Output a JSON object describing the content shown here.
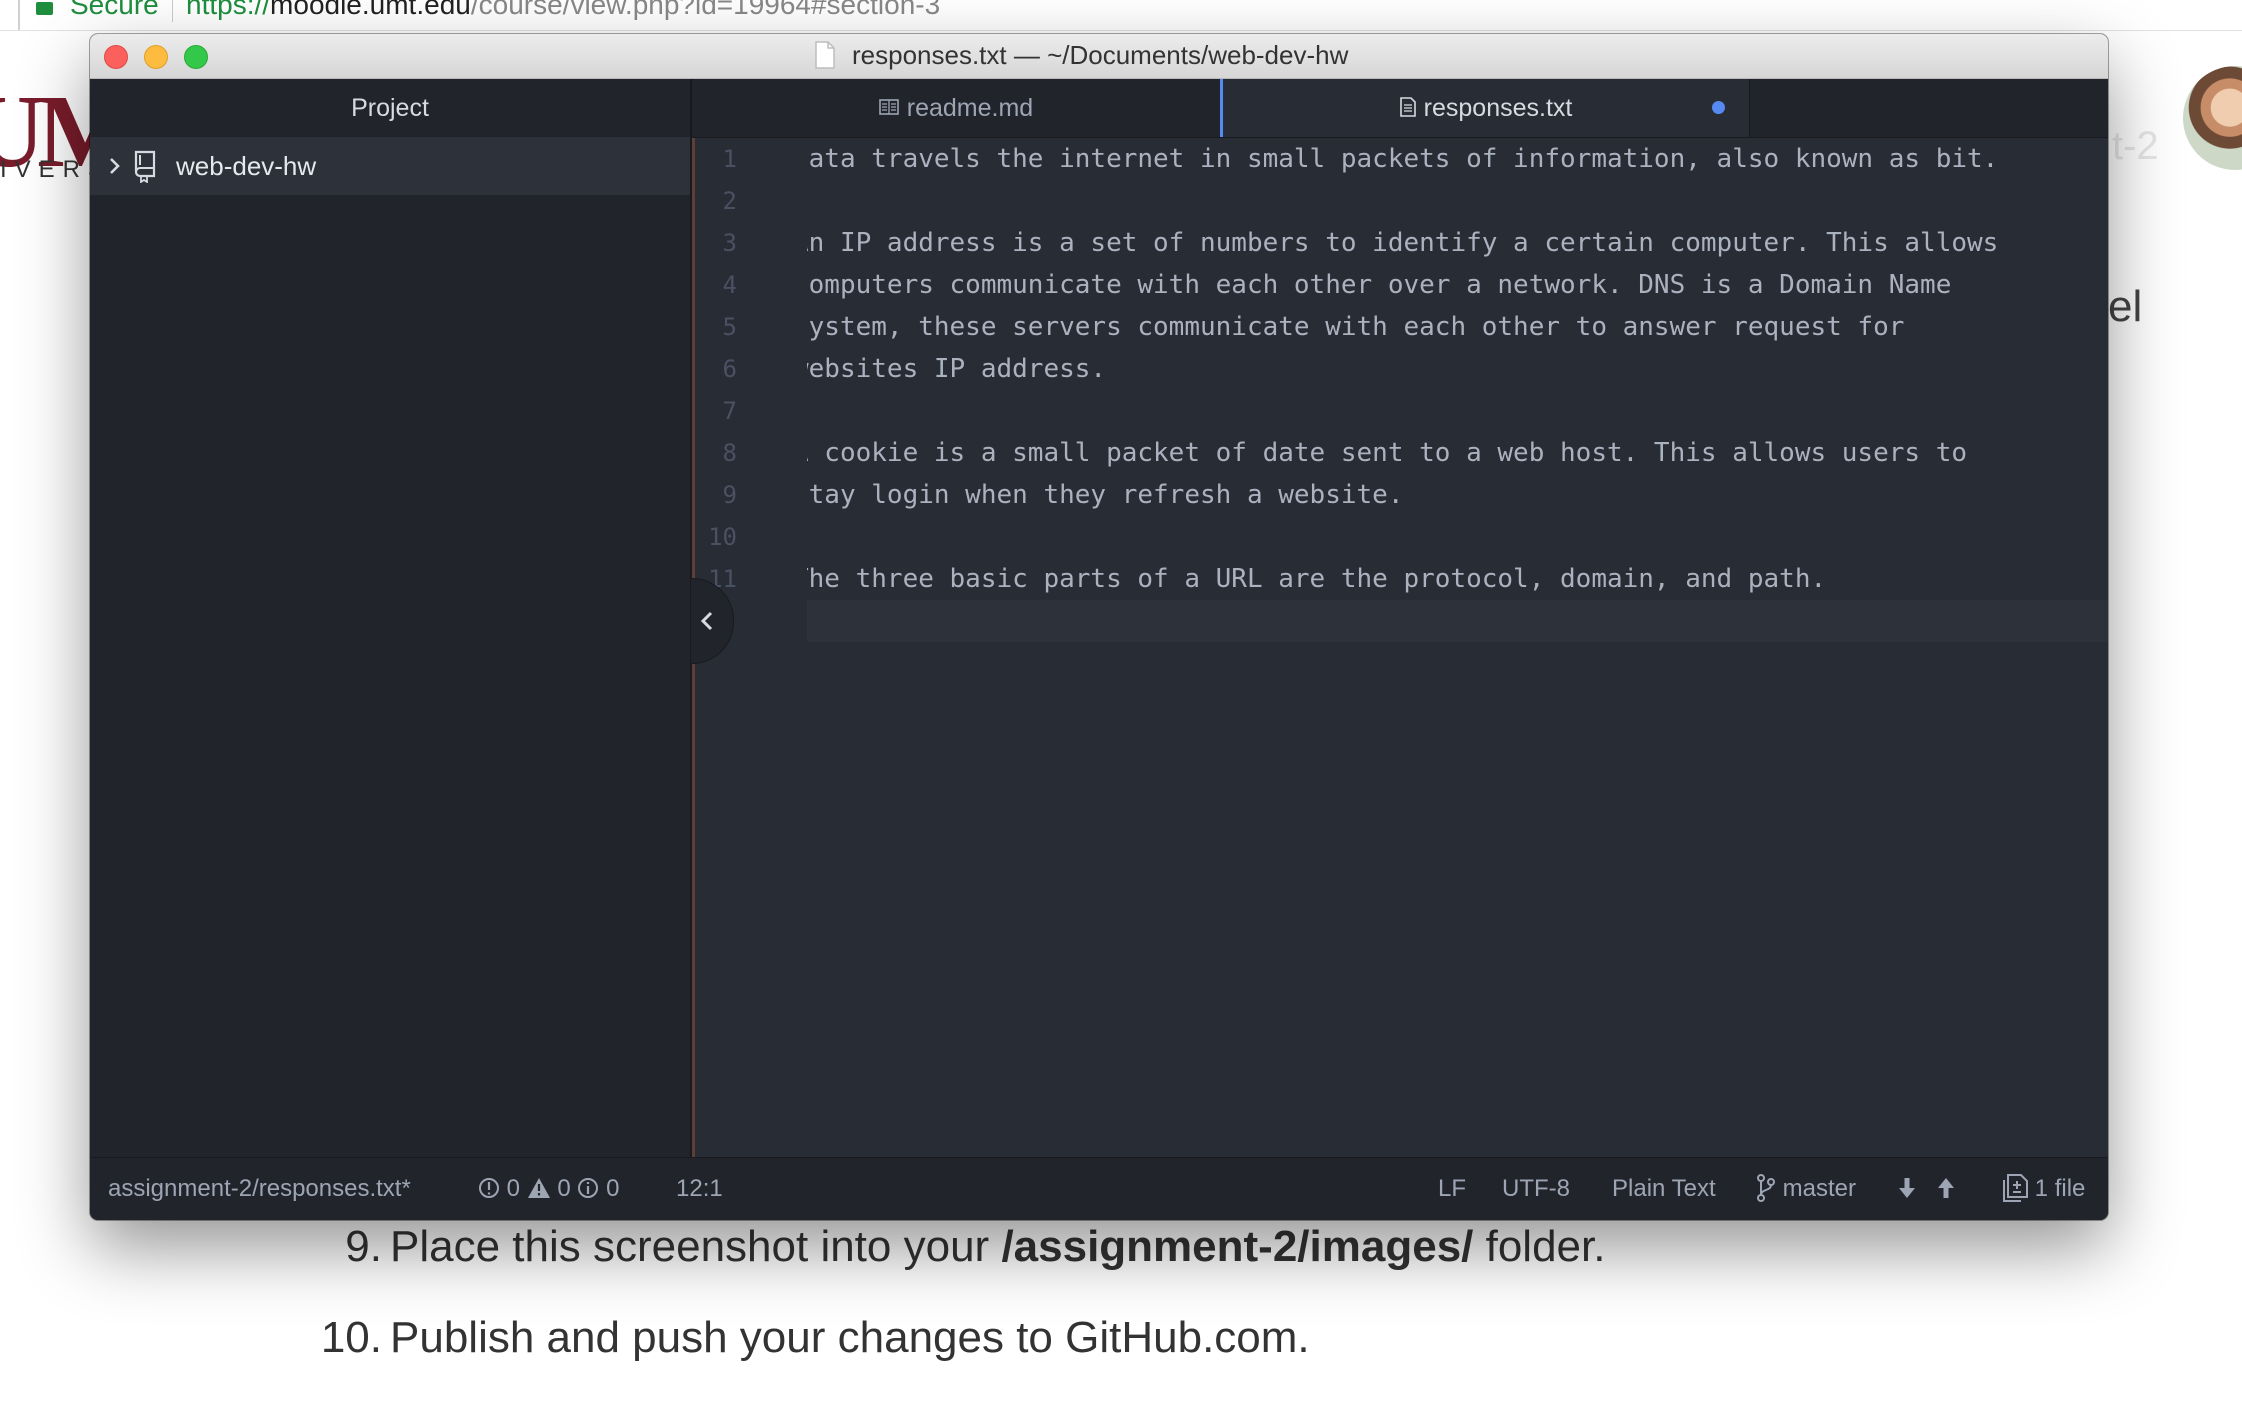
{
  "browser": {
    "secure_label": "Secure",
    "url_scheme": "https://",
    "url_host": "moodle.umt.edu",
    "url_path": "/course/view.php?id=19964#section-3",
    "side_text": "el",
    "faded_tail": "t-2"
  },
  "site": {
    "logo": "UM",
    "logo_sub": "IVERS"
  },
  "page": {
    "steps": [
      {
        "num": "9.",
        "pre": "Place this screenshot into your ",
        "bold": "/assignment-2/images/",
        "post": " folder."
      },
      {
        "num": "10.",
        "pre": "Publish and push your changes to GitHub.com.",
        "bold": "",
        "post": ""
      }
    ]
  },
  "window": {
    "title": "responses.txt — ~/Documents/web-dev-hw",
    "tree": {
      "header": "Project",
      "root": "web-dev-hw"
    },
    "tabs": [
      {
        "label": "readme.md",
        "icon": "book-icon",
        "active": false
      },
      {
        "label": "responses.txt",
        "icon": "file-text-icon",
        "active": true,
        "modified": true
      }
    ],
    "editor": {
      "line_numbers": [
        "1",
        "2",
        "3",
        "4",
        "5",
        "6",
        "7",
        "8",
        "9",
        "10",
        "11"
      ],
      "lines": [
        "Data travels the internet in small packets of information, also known as bit.",
        "",
        "An IP address is a set of numbers to identify a certain computer. This allows",
        "computers communicate with each other over a network. DNS is a Domain Name",
        "System, these servers communicate with each other to answer request for",
        "websites IP address.",
        "",
        "A cookie is a small packet of date sent to a web host. This allows users to",
        "stay login when they refresh a website.",
        "",
        "The three basic parts of a URL are the protocol, domain, and path."
      ]
    },
    "status": {
      "file_path": "assignment-2/responses.txt*",
      "errors": "0",
      "warnings": "0",
      "infos": "0",
      "cursor": "12:1",
      "line_ending": "LF",
      "encoding": "UTF-8",
      "grammar": "Plain Text",
      "branch": "master",
      "changed_files": "1 file"
    }
  },
  "colors": {
    "accent": "#568af2",
    "editor_bg": "#282c34",
    "panel_bg": "#21252b",
    "secure_green": "#1e8e3e",
    "logo_maroon": "#7a1c2b"
  }
}
